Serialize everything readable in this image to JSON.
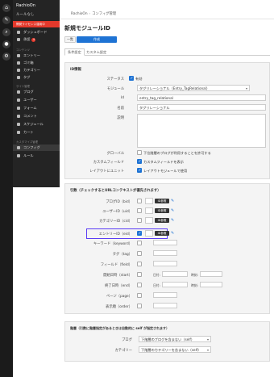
{
  "rail": {
    "icons": [
      "home-icon",
      "pen-icon",
      "search-icon",
      "user-icon",
      "gear-icon"
    ]
  },
  "sidebar": {
    "site_name": "RachioOn",
    "selector": "ルールなし",
    "license_warning": "開発ライセンス運用中",
    "items": [
      {
        "label": "ダッシュボード",
        "icon": "dashboard-icon"
      },
      {
        "label": "承認",
        "icon": "check-icon",
        "badge": "4"
      },
      {
        "label": "エントリー",
        "icon": "entry-icon"
      },
      {
        "label": "ゴミ箱",
        "icon": "trash-icon"
      },
      {
        "label": "カテゴリー",
        "icon": "folder-icon"
      },
      {
        "label": "タグ",
        "icon": "tag-icon"
      },
      {
        "label": "ブログ",
        "icon": "blog-icon"
      },
      {
        "label": "ユーザー",
        "icon": "user-icon"
      },
      {
        "label": "フォーム",
        "icon": "form-icon"
      },
      {
        "label": "コメント",
        "icon": "comment-icon"
      },
      {
        "label": "スケジュール",
        "icon": "calendar-icon"
      },
      {
        "label": "カート",
        "icon": "cart-icon"
      },
      {
        "label": "コンフィグ",
        "icon": "config-icon"
      },
      {
        "label": "ルール",
        "icon": "rule-icon"
      }
    ],
    "groups": [
      "コンテンツ",
      "サイト管理",
      "カスタマイズ管理"
    ]
  },
  "header": {
    "crumbs": [
      "RachioOn",
      "コンフィグ管理"
    ]
  },
  "page": {
    "title": "新規モジュールID",
    "back_label": "一覧",
    "save_label": "作成",
    "tabs": [
      "条件設定",
      "カスタム設定"
    ]
  },
  "id_panel": {
    "heading": "ID情報",
    "status_label": "ステータス",
    "status_value": "有効",
    "module_label": "モジュール",
    "module_value": "タグリレーショナル（Entry_TagRelational）",
    "id_label": "Id",
    "id_value": "entry_tag_relational",
    "name_label": "名前",
    "name_value": "タグリレーショナル",
    "desc_label": "説明",
    "global_label": "グローバル",
    "global_text": "下位階層のブログが利用することを許可する",
    "custom_field_label": "カスタムフィールド",
    "custom_field_text": "カスタムフィールドを表示",
    "layout_label": "レイアウトにユニット",
    "layout_text": "レイアウトモジュールで使用"
  },
  "args_panel": {
    "heading": "引数（チェックするとURLコンテキストが優先されます）",
    "ids_pill": "ID参照",
    "rows": [
      {
        "label": "ブログID（bid）",
        "checked": false,
        "pill": true
      },
      {
        "label": "ユーザーID（uid）",
        "checked": false,
        "pill": true
      },
      {
        "label": "カテゴリーID（cid）",
        "checked": false,
        "pill": true
      },
      {
        "label": "エントリーID（eid）",
        "checked": true,
        "pill": true
      },
      {
        "label": "キーワード（keyword）",
        "checked": false,
        "pill": false
      },
      {
        "label": "タグ（tag）",
        "checked": false,
        "pill": false
      },
      {
        "label": "フィールド（field）",
        "checked": false,
        "pill": false
      },
      {
        "label": "開始日時（start）",
        "checked": false,
        "pill": false,
        "dt": true
      },
      {
        "label": "終了日時（end）",
        "checked": false,
        "pill": false,
        "dt": true
      },
      {
        "label": "ページ（page）",
        "checked": false,
        "pill": false
      },
      {
        "label": "表示順（order）",
        "checked": false,
        "pill": false
      }
    ],
    "date_label": "日付:",
    "time_label": "時刻:"
  },
  "scope_panel": {
    "heading": "階層（引数に階層指定があるときは自動的に self が指定されます）",
    "blog_label": "ブログ",
    "blog_value": "下階層のブログを含まない（self）",
    "category_label": "カテゴリー",
    "category_value": "下階層のカテゴリーを含まない（self）"
  },
  "colors": {
    "accent": "#1e73d4",
    "danger": "#e4382b",
    "highlight": "#5b3df5"
  }
}
